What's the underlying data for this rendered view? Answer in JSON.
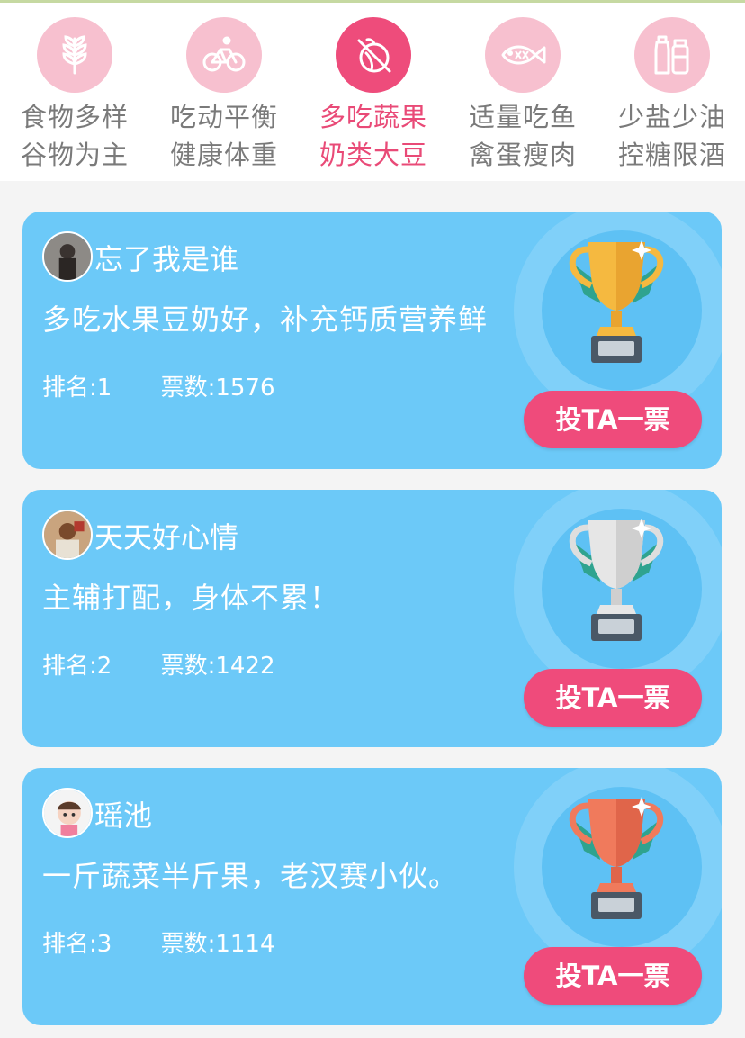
{
  "tabs": [
    {
      "line1": "食物多样",
      "line2": "谷物为主",
      "icon": "wheat-icon",
      "active": false
    },
    {
      "line1": "吃动平衡",
      "line2": "健康体重",
      "icon": "bicycle-icon",
      "active": false
    },
    {
      "line1": "多吃蔬果",
      "line2": "奶类大豆",
      "icon": "vegetable-icon",
      "active": true
    },
    {
      "line1": "适量吃鱼",
      "line2": "禽蛋瘦肉",
      "icon": "fish-icon",
      "active": false
    },
    {
      "line1": "少盐少油",
      "line2": "控糖限酒",
      "icon": "bottles-icon",
      "active": false
    }
  ],
  "entries": [
    {
      "username": "忘了我是谁",
      "message": "多吃水果豆奶好，补充钙质营养鲜",
      "rank": "排名:1",
      "votes": "票数:1576",
      "vote_label": "投TA一票",
      "trophy": "gold-trophy-icon",
      "trophy_color": "#f5b940"
    },
    {
      "username": "天天好心情",
      "message": "主辅打配，身体不累！",
      "rank": "排名:2",
      "votes": "票数:1422",
      "vote_label": "投TA一票",
      "trophy": "silver-trophy-icon",
      "trophy_color": "#dedede"
    },
    {
      "username": "瑶池",
      "message": "一斤蔬菜半斤果，老汉赛小伙。",
      "rank": "排名:3",
      "votes": "票数:1114",
      "vote_label": "投TA一票",
      "trophy": "bronze-trophy-icon",
      "trophy_color": "#f07a5c"
    }
  ],
  "colors": {
    "accent_pink": "#ee4c7b",
    "tab_inactive_circle": "#f7c0cf",
    "card_blue": "#6cc9f8"
  }
}
